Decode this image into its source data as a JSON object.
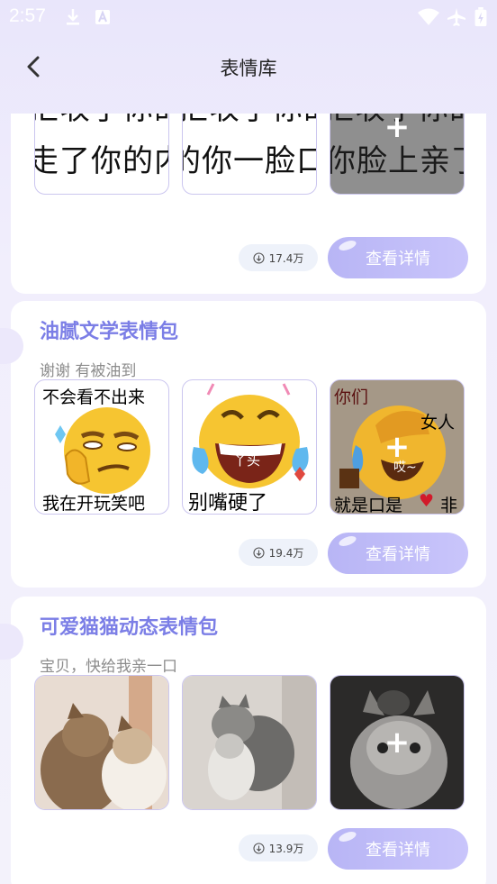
{
  "status": {
    "time": "2:57"
  },
  "header": {
    "title": "表情库"
  },
  "cards": [
    {
      "title": "",
      "subtitle": "",
      "downloads": "17.4万",
      "button": "查看详情",
      "thumbs": [
        {
          "line1": "拒收了你的",
          "line2": "走了你的内"
        },
        {
          "line1": "拒收了你的",
          "line2": "的你一脸口"
        },
        {
          "line1": "拒收了你的",
          "line2": "你脸上亲了"
        }
      ]
    },
    {
      "title": "油腻文学表情包",
      "subtitle": "谢谢 有被油到",
      "downloads": "19.4万",
      "button": "查看详情",
      "thumbs": [
        {
          "top": "不会看不出来",
          "bottom": "我在开玩笑吧"
        },
        {
          "mid": "丫头",
          "bottom": "别嘴硬了"
        },
        {
          "top": "你们",
          "right": "女人",
          "mid": "哎~",
          "bottom": "就是口是",
          "end": "非"
        }
      ]
    },
    {
      "title": "可爱猫猫动态表情包",
      "subtitle": "宝贝，快给我亲一口",
      "downloads": "13.9万",
      "button": "查看详情"
    }
  ],
  "colors": {
    "accent": "#7b7ee6",
    "button": "#b8b5f5"
  }
}
